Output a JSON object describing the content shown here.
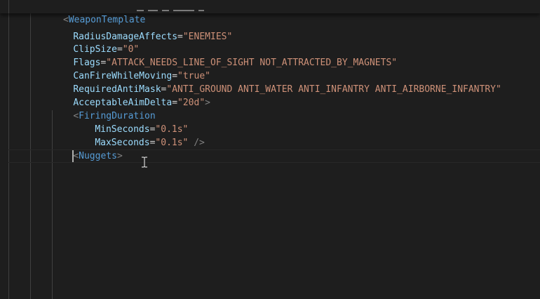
{
  "editor": {
    "sticky_header": {
      "open": "<",
      "tag": "WeaponTemplate"
    },
    "lines": [
      {
        "attr": "RadiusDamageAffects",
        "eq": "=",
        "value": "\"ENEMIES\"",
        "close": ""
      },
      {
        "attr": "ClipSize",
        "eq": "=",
        "value": "\"0\"",
        "close": ""
      },
      {
        "attr": "Flags",
        "eq": "=",
        "value": "\"ATTACK_NEEDS_LINE_OF_SIGHT NOT_ATTRACTED_BY_MAGNETS\"",
        "close": ""
      },
      {
        "attr": "CanFireWhileMoving",
        "eq": "=",
        "value": "\"true\"",
        "close": ""
      },
      {
        "attr": "RequiredAntiMask",
        "eq": "=",
        "value": "\"ANTI_GROUND ANTI_WATER ANTI_INFANTRY ANTI_AIRBORNE_INFANTRY\"",
        "close": ""
      },
      {
        "attr": "AcceptableAimDelta",
        "eq": "=",
        "value": "\"20d\"",
        "close": ">"
      }
    ],
    "firing_duration": {
      "open": "<",
      "tag": "FiringDuration",
      "min_attr": "MinSeconds",
      "min_eq": "=",
      "min_value": "\"0.1s\"",
      "max_attr": "MaxSeconds",
      "max_eq": "=",
      "max_value": "\"0.1s\"",
      "self_close": " />"
    },
    "nuggets": {
      "open": "<",
      "tag": "Nuggets",
      "close": ">"
    }
  },
  "colors": {
    "background": "#1e1e1e",
    "tag": "#569cd6",
    "attribute": "#9cdcfe",
    "string": "#ce9178",
    "punctuation": "#808080",
    "indent_guide": "#404040"
  }
}
